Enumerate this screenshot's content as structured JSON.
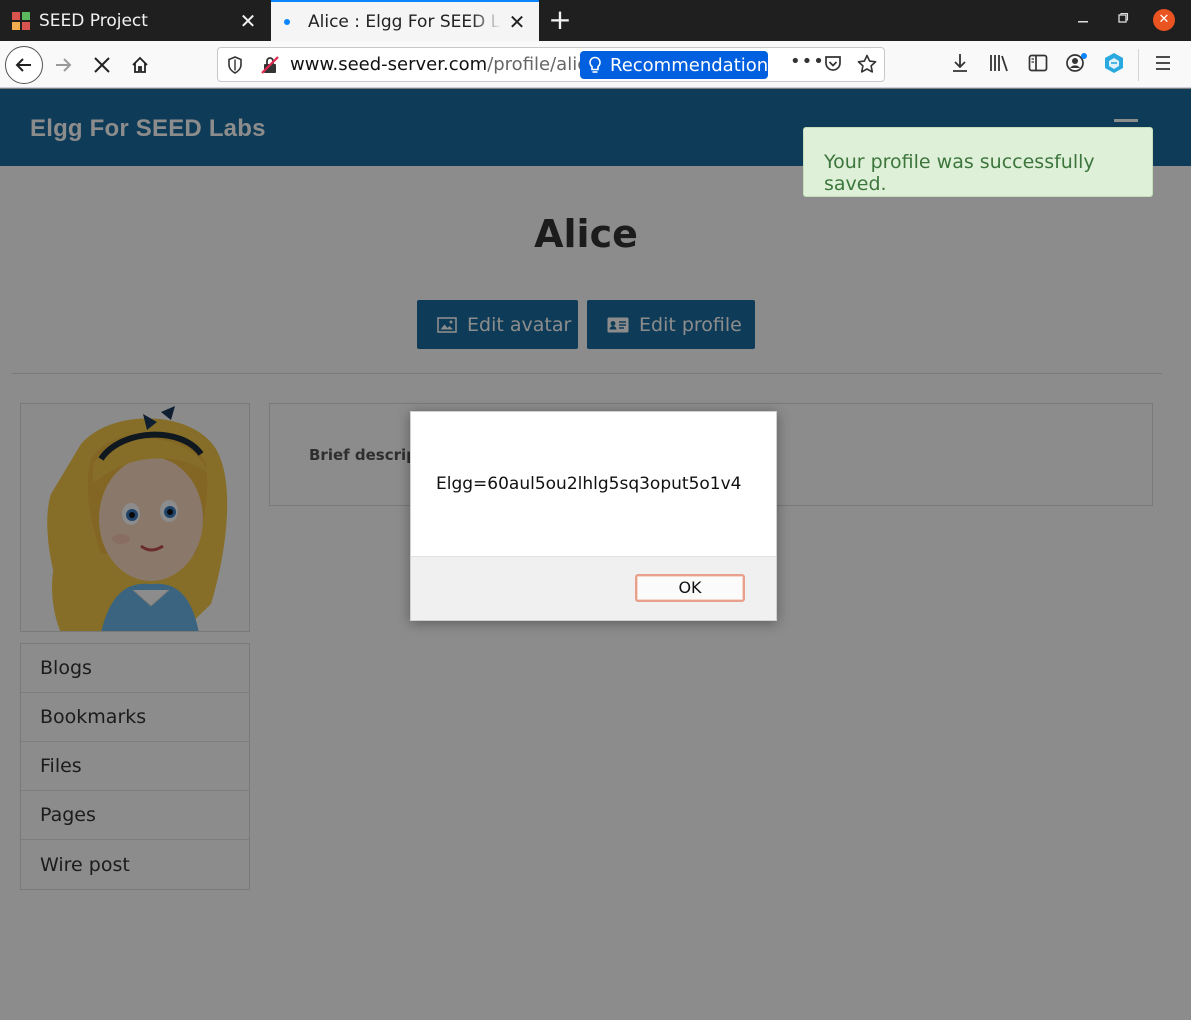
{
  "browser": {
    "tabs": [
      {
        "title": "SEED Project",
        "close": "✕"
      },
      {
        "title": "Alice : Elgg For SEED Labs",
        "close": "✕"
      }
    ],
    "new_tab": "+",
    "url_host": "www.seed-server.com",
    "url_path": "/profile/alice",
    "recommendation_label": "Recommendation",
    "page_actions_more": "•••"
  },
  "site": {
    "title": "Elgg For SEED Labs"
  },
  "toast": {
    "message": "Your profile was successfully saved."
  },
  "profile": {
    "name": "Alice",
    "edit_avatar_label": "Edit avatar",
    "edit_profile_label": "Edit profile",
    "brief_description_label": "Brief descrip",
    "menu": [
      "Blogs",
      "Bookmarks",
      "Files",
      "Pages",
      "Wire post"
    ]
  },
  "alert": {
    "message": "Elgg=60aul5ou2lhlg5sq3oput5o1v4",
    "ok_label": "OK"
  },
  "colors": {
    "elgg_blue": "#1b6c9e",
    "firefox_blue": "#0060df",
    "toast_bg": "#dff0d8",
    "toast_text": "#3c763d",
    "ubuntu_orange": "#e95420"
  }
}
